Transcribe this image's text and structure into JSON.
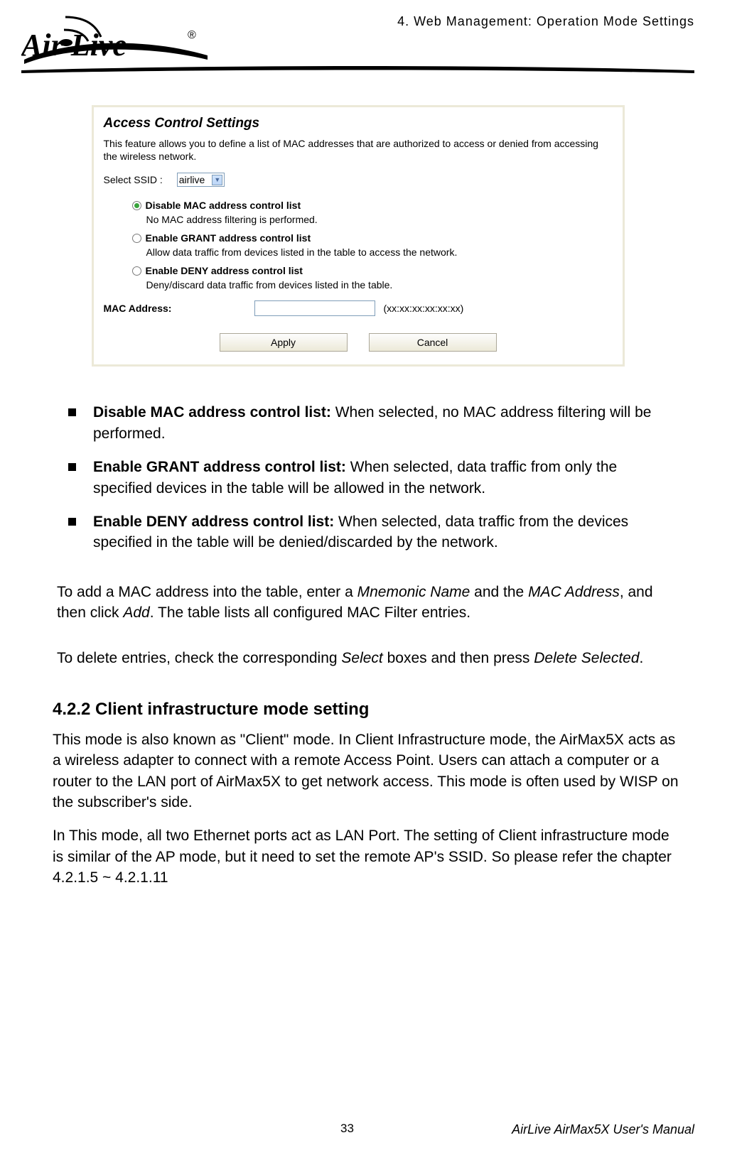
{
  "header": {
    "chapter_title": "4. Web Management: Operation Mode Settings",
    "logo_text_main": "Air Live",
    "logo_reg": "®"
  },
  "acs": {
    "title": "Access Control Settings",
    "description": "This feature allows you to define a list of MAC addresses that are authorized to access or denied from accessing the wireless network.",
    "ssid_label": "Select SSID :",
    "ssid_value": "airlive",
    "opt_disable_label": "Disable MAC address control list",
    "opt_disable_desc": "No MAC address filtering is performed.",
    "opt_grant_label": "Enable GRANT address control list",
    "opt_grant_desc": "Allow data traffic from devices listed in the table to access the network.",
    "opt_deny_label": "Enable DENY address control list",
    "opt_deny_desc": "Deny/discard data traffic from devices listed in the table.",
    "mac_label": "MAC Address:",
    "mac_hint": "(xx:xx:xx:xx:xx:xx)",
    "btn_apply": "Apply",
    "btn_cancel": "Cancel"
  },
  "bullets": {
    "b1_title": "Disable MAC address control list:",
    "b1_body": " When selected, no MAC address filtering will be performed.",
    "b2_title": "Enable GRANT address control list:",
    "b2_body": " When selected, data traffic from only the specified devices in the table will be allowed in the network.",
    "b3_title": "Enable DENY address control list:",
    "b3_body": " When selected, data traffic from the devices specified in the table will be denied/discarded by the network."
  },
  "paras": {
    "p1_a": "To add a MAC address into the table, enter a ",
    "p1_i1": "Mnemonic Name",
    "p1_b": " and the ",
    "p1_i2": "MAC Address",
    "p1_c": ", and then click ",
    "p1_i3": "Add",
    "p1_d": ". The table lists all configured MAC Filter entries.",
    "p2_a": "To delete entries, check the corresponding ",
    "p2_i1": "Select",
    "p2_b": " boxes and then press ",
    "p2_i2": "Delete Selected",
    "p2_c": "."
  },
  "section": {
    "heading": "4.2.2 Client infrastructure mode setting",
    "body1": "This mode is also known as \"Client\" mode. In Client Infrastructure mode, the AirMax5X acts as a wireless adapter to connect with a remote Access Point. Users can attach a computer or a router to the LAN port of AirMax5X to get network access. This mode is often used by WISP on the subscriber's side.",
    "body2": "In This mode, all two Ethernet ports act as LAN Port. The setting of Client infrastructure mode is similar of the AP mode, but it need to set the remote AP's SSID.   So please refer the chapter 4.2.1.5 ~ 4.2.1.11"
  },
  "footer": {
    "page_number": "33",
    "manual_title": "AirLive AirMax5X User's Manual"
  }
}
